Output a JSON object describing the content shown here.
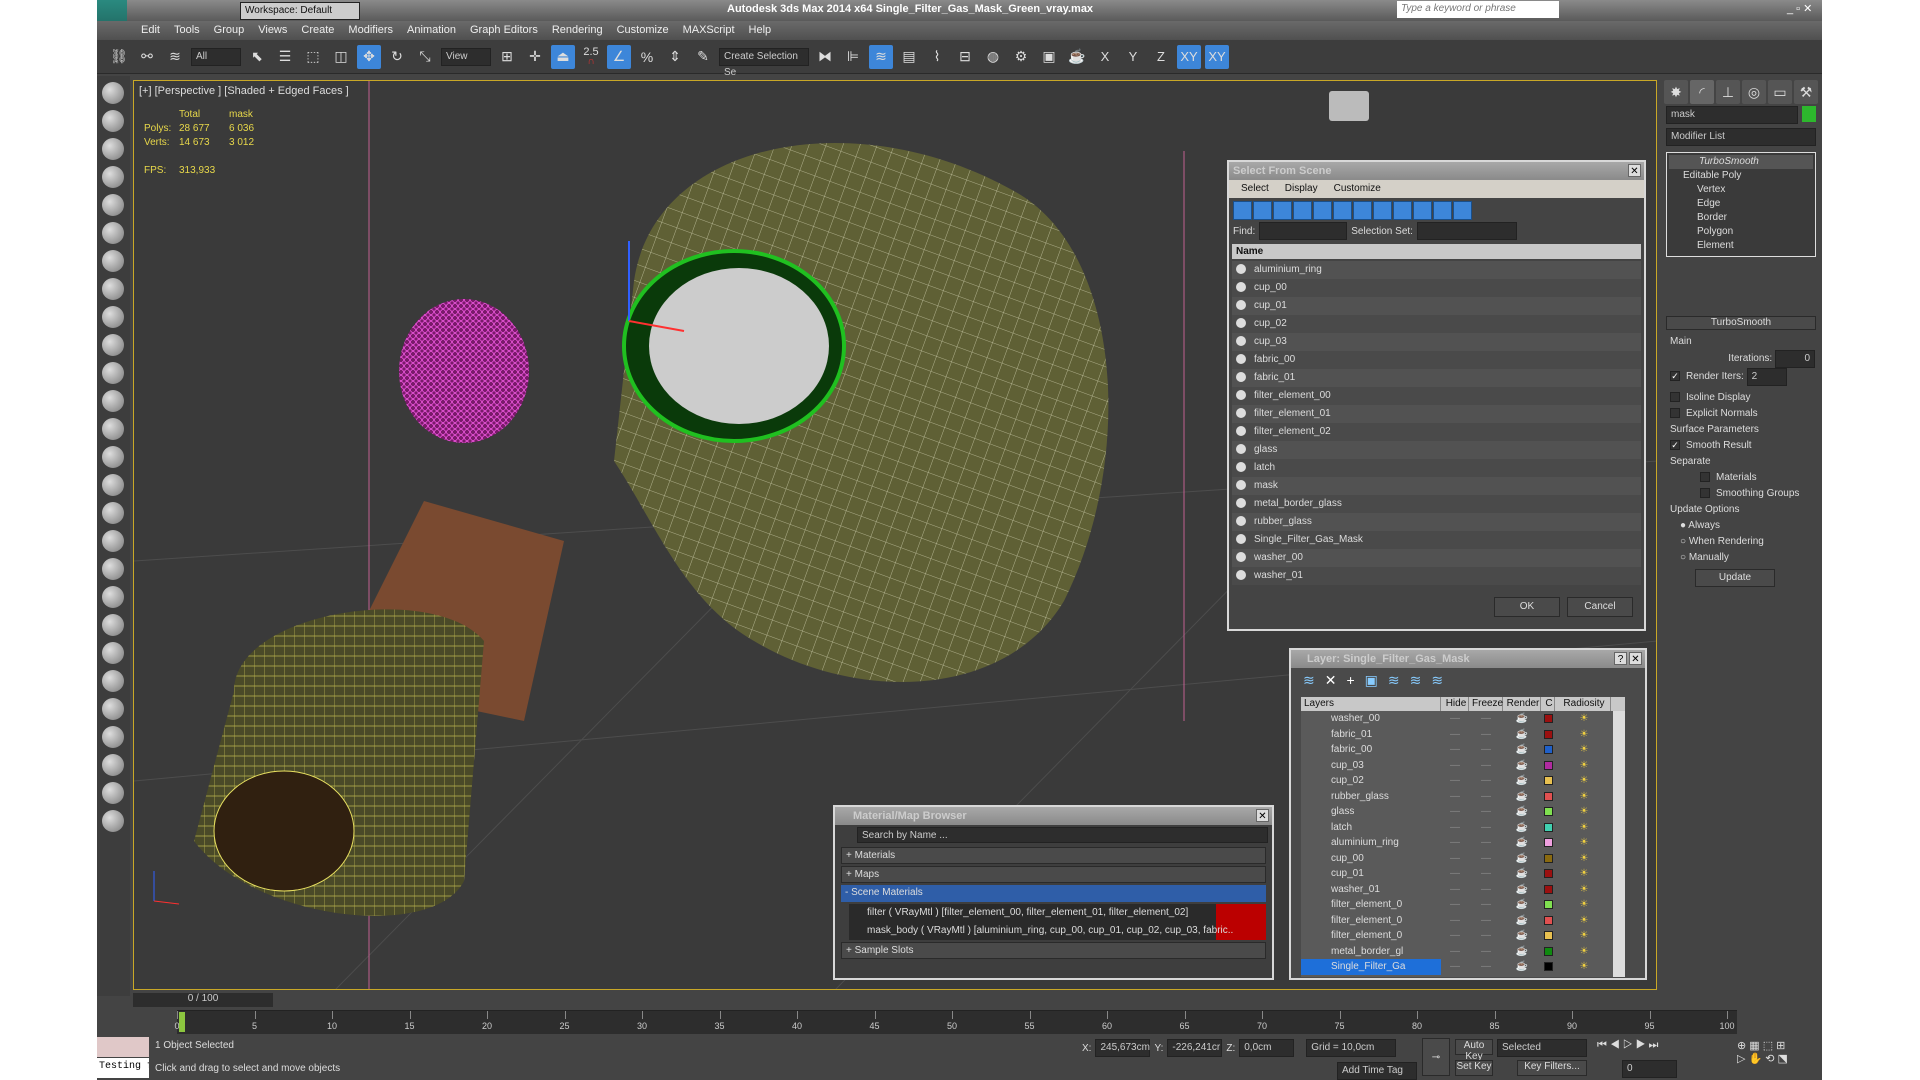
{
  "app": {
    "title": "Autodesk 3ds Max  2014 x64     Single_Filter_Gas_Mask_Green_vray.max",
    "workspace": "Workspace: Default",
    "search_placeholder": "Type a keyword or phrase"
  },
  "menu": [
    "Edit",
    "Tools",
    "Group",
    "Views",
    "Create",
    "Modifiers",
    "Animation",
    "Graph Editors",
    "Rendering",
    "Customize",
    "MAXScript",
    "Help"
  ],
  "toolbar": {
    "filter": "All",
    "coord": "View",
    "snap_angle": "2.5",
    "named_sel": "Create Selection Se",
    "axes": [
      "X",
      "Y",
      "Z",
      "XY",
      "XY"
    ],
    "icons": [
      "link-icon",
      "unlink-icon",
      "bind-space-warp-icon"
    ],
    "icons2": [
      "select-object-icon",
      "select-by-name-icon",
      "rect-region-icon",
      "window-crossing-icon",
      "move-icon",
      "rotate-icon",
      "scale-icon"
    ],
    "icons3": [
      "pivot-icon",
      "manipulate-icon",
      "keyboard-shortcut-icon",
      "snap-icon",
      "angle-snap-icon",
      "percent-snap-icon",
      "spinner-snap-icon",
      "edit-named-sel-icon"
    ],
    "icons4": [
      "mirror-icon",
      "align-icon",
      "layer-manager-icon",
      "graphite-icon",
      "curve-editor-icon",
      "schematic-icon",
      "material-editor-icon",
      "render-setup-icon",
      "rendered-frame-icon",
      "render-icon"
    ]
  },
  "viewport": {
    "label": "[+] [Perspective ] [Shaded + Edged Faces ]",
    "stats": {
      "col1": "Total",
      "col2": "mask",
      "polys_label": "Polys:",
      "polys_total": "28 677",
      "polys_mask": "6 036",
      "verts_label": "Verts:",
      "verts_total": "14 673",
      "verts_mask": "3 012",
      "fps_label": "FPS:",
      "fps": "313,933"
    }
  },
  "cmd": {
    "object_name": "mask",
    "object_color": "#2db82d",
    "modifier_list": "Modifier List",
    "stack": [
      "TurboSmooth",
      "Editable Poly",
      "Vertex",
      "Edge",
      "Border",
      "Polygon",
      "Element"
    ],
    "rollout": "TurboSmooth",
    "main": "Main",
    "iterations_label": "Iterations:",
    "iterations": "0",
    "render_iters_label": "Render Iters:",
    "render_iters": "2",
    "isoline": "Isoline Display",
    "explicit": "Explicit Normals",
    "surface": "Surface Parameters",
    "smooth_result": "Smooth Result",
    "separate": "Separate",
    "materials": "Materials",
    "smoothing_groups": "Smoothing Groups",
    "update_options": "Update Options",
    "always": "Always",
    "when_rendering": "When Rendering",
    "manually": "Manually",
    "update": "Update"
  },
  "select_scene": {
    "title": "Select From Scene",
    "menu": [
      "Select",
      "Display",
      "Customize"
    ],
    "find_label": "Find:",
    "selset_label": "Selection Set:",
    "col_name": "Name",
    "items": [
      "aluminium_ring",
      "cup_00",
      "cup_01",
      "cup_02",
      "cup_03",
      "fabric_00",
      "fabric_01",
      "filter_element_00",
      "filter_element_01",
      "filter_element_02",
      "glass",
      "latch",
      "mask",
      "metal_border_glass",
      "rubber_glass",
      "Single_Filter_Gas_Mask",
      "washer_00",
      "washer_01"
    ],
    "ok": "OK",
    "cancel": "Cancel"
  },
  "layers": {
    "title": "Layer: Single_Filter_Gas_Mask",
    "help": "?",
    "cols": [
      "Layers",
      "Hide",
      "Freeze",
      "Render",
      "C",
      "Radiosity"
    ],
    "rows": [
      {
        "name": "washer_00",
        "color": "#9b1010"
      },
      {
        "name": "fabric_01",
        "color": "#9b1010"
      },
      {
        "name": "fabric_00",
        "color": "#2060c8"
      },
      {
        "name": "cup_03",
        "color": "#b02aa0"
      },
      {
        "name": "cup_02",
        "color": "#e8c050"
      },
      {
        "name": "rubber_glass",
        "color": "#e05050"
      },
      {
        "name": "glass",
        "color": "#80e050"
      },
      {
        "name": "latch",
        "color": "#40d0b0"
      },
      {
        "name": "aluminium_ring",
        "color": "#f0a0e0"
      },
      {
        "name": "cup_00",
        "color": "#8a6a10"
      },
      {
        "name": "cup_01",
        "color": "#9b1010"
      },
      {
        "name": "washer_01",
        "color": "#9b1010"
      },
      {
        "name": "filter_element_0",
        "color": "#80e050"
      },
      {
        "name": "filter_element_0",
        "color": "#e05050"
      },
      {
        "name": "filter_element_0",
        "color": "#e8c050"
      },
      {
        "name": "metal_border_gl",
        "color": "#108a10"
      },
      {
        "name": "Single_Filter_Ga",
        "color": "#000000"
      }
    ]
  },
  "matbrowser": {
    "title": "Material/Map Browser",
    "search_placeholder": "Search by Name ...",
    "groups": [
      "+ Materials",
      "+ Maps"
    ],
    "scene": "- Scene Materials",
    "materials": [
      "filter  ( VRayMtl ) [filter_element_00, filter_element_01, filter_element_02]",
      "mask_body  ( VRayMtl ) [aluminium_ring, cup_00, cup_01, cup_02, cup_03, fabric.."
    ],
    "sample": "+ Sample Slots"
  },
  "timeline": {
    "frame": "0 / 100",
    "ticks": [
      "0",
      "5",
      "10",
      "15",
      "20",
      "25",
      "30",
      "35",
      "40",
      "45",
      "50",
      "55",
      "60",
      "65",
      "70",
      "75",
      "80",
      "85",
      "90",
      "95",
      "100"
    ]
  },
  "status": {
    "selected": "1 Object Selected",
    "prompt": "Click and drag to select and move objects",
    "maxscript": "Testing for :",
    "x_label": "X:",
    "x": "245,673cm",
    "y_label": "Y:",
    "y": "-226,241cr",
    "z_label": "Z:",
    "z": "0,0cm",
    "grid": "Grid = 10,0cm",
    "add_time_tag": "Add Time Tag",
    "auto_key": "Auto Key",
    "set_key": "Set Key",
    "key_mode": "Selected",
    "key_filters": "Key Filters...",
    "current_frame": "0"
  }
}
